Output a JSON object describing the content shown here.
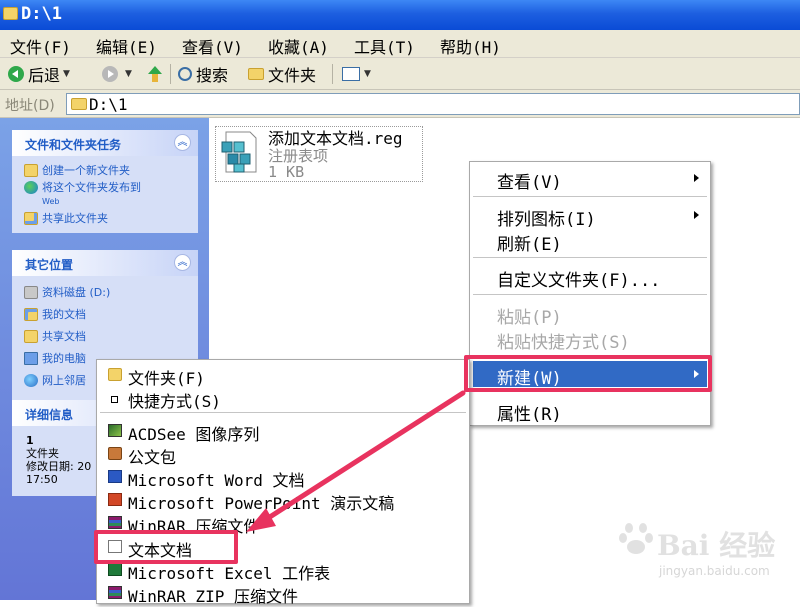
{
  "window": {
    "title": "D:\\1"
  },
  "menubar": [
    "文件(F)",
    "编辑(E)",
    "查看(V)",
    "收藏(A)",
    "工具(T)",
    "帮助(H)"
  ],
  "toolbar": {
    "back": "后退",
    "search": "搜索",
    "folders": "文件夹"
  },
  "address": {
    "label": "地址(D)",
    "value": "D:\\1"
  },
  "tasks_panel": {
    "title": "文件和文件夹任务",
    "items": [
      "创建一个新文件夹",
      "将这个文件夹发布到",
      "Web",
      "共享此文件夹"
    ]
  },
  "places_panel": {
    "title": "其它位置",
    "items": [
      "资料磁盘 (D:)",
      "我的文档",
      "共享文档",
      "我的电脑",
      "网上邻居"
    ]
  },
  "details_panel": {
    "title": "详细信息",
    "name": "1",
    "type": "文件夹",
    "modified_label": "修改日期: 20",
    "modified_time": "17:50"
  },
  "file": {
    "name": "添加文本文档.reg",
    "type": "注册表项",
    "size": "1 KB"
  },
  "context_menu": {
    "items": [
      "查看(V)",
      "排列图标(I)",
      "刷新(E)",
      "自定义文件夹(F)...",
      "粘贴(P)",
      "粘贴快捷方式(S)",
      "新建(W)",
      "属性(R)"
    ]
  },
  "new_submenu": {
    "items": [
      "文件夹(F)",
      "快捷方式(S)",
      "ACDSee 图像序列",
      "公文包",
      "Microsoft Word 文档",
      "Microsoft PowerPoint 演示文稿",
      "WinRAR 压缩文件",
      "文本文档",
      "Microsoft Excel 工作表",
      "WinRAR ZIP 压缩文件"
    ]
  },
  "watermark": {
    "brand": "Bai 经验",
    "url": "jingyan.baidu.com"
  },
  "colors": {
    "highlight": "#316ac5",
    "annotation": "#e8335f",
    "taskpane": "#6375d6"
  }
}
